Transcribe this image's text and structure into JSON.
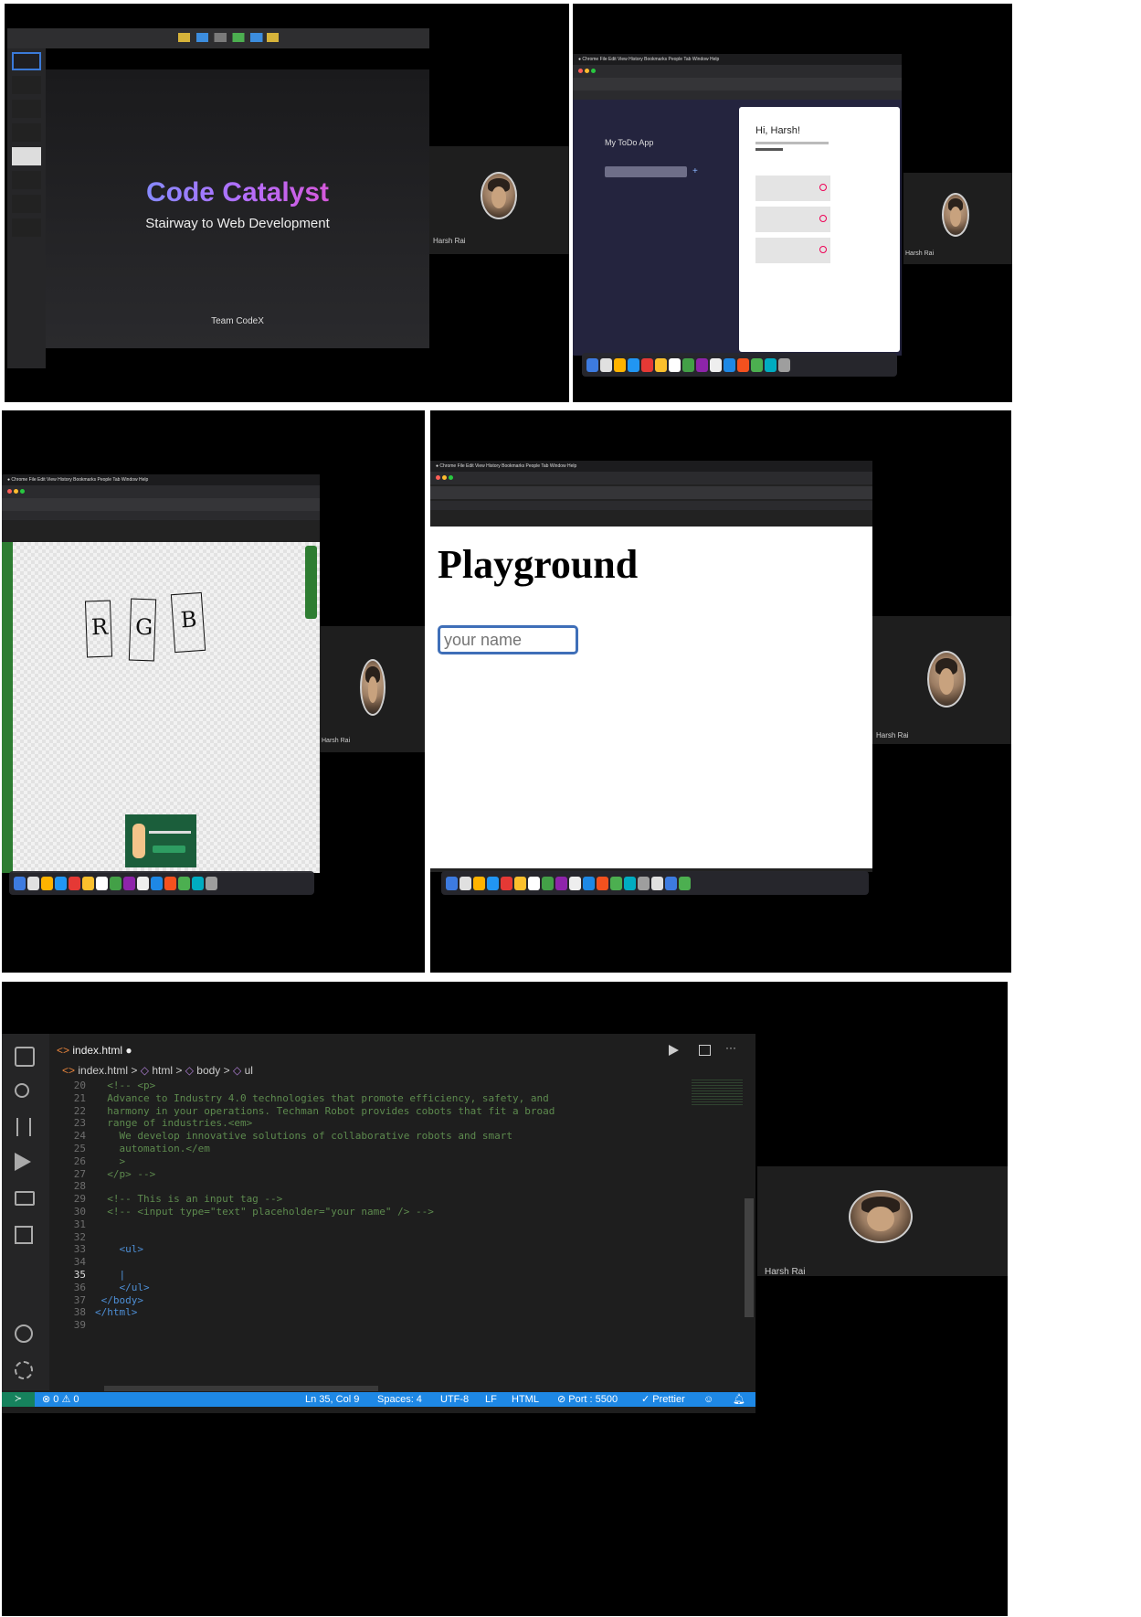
{
  "participant_name": "Harsh Rai",
  "slide": {
    "title": "Code Catalyst",
    "subtitle": "Stairway to Web Development",
    "footer": "Team CodeX"
  },
  "todo": {
    "app_title": "My ToDo App",
    "greeting": "Hi, Harsh!"
  },
  "whiteboard": {
    "letters": [
      "R",
      "G",
      "B"
    ]
  },
  "playground": {
    "heading": "Playground",
    "input_placeholder": "your name"
  },
  "editor": {
    "tab_label": "index.html",
    "breadcrumb": [
      "index.html",
      "html",
      "body",
      "ul"
    ],
    "lines": [
      {
        "n": "20",
        "text": "  <!-- <p>",
        "cls": "cm"
      },
      {
        "n": "21",
        "text": "  Advance to Industry 4.0 technologies that promote efficiency, safety, and",
        "cls": "cm"
      },
      {
        "n": "22",
        "text": "  harmony in your operations. Techman Robot provides cobots that fit a broad",
        "cls": "cm"
      },
      {
        "n": "23",
        "text": "  range of industries.<em>",
        "cls": "cm"
      },
      {
        "n": "24",
        "text": "    We develop innovative solutions of collaborative robots and smart",
        "cls": "cm"
      },
      {
        "n": "25",
        "text": "    automation.</em",
        "cls": "cm"
      },
      {
        "n": "26",
        "text": "    >",
        "cls": "cm"
      },
      {
        "n": "27",
        "text": "  </p> -->",
        "cls": "cm"
      },
      {
        "n": "28",
        "text": "",
        "cls": "cm"
      },
      {
        "n": "29",
        "text": "  <!-- This is an input tag -->",
        "cls": "cm"
      },
      {
        "n": "30",
        "text": "  <!-- <input type=\"text\" placeholder=\"your name\" /> -->",
        "cls": "cm"
      },
      {
        "n": "31",
        "text": "",
        "cls": "cm"
      },
      {
        "n": "32",
        "text": "",
        "cls": "cm"
      },
      {
        "n": "33",
        "text": "    <ul>",
        "cls": "tg"
      },
      {
        "n": "34",
        "text": "",
        "cls": "tg"
      },
      {
        "n": "35",
        "text": "    |",
        "cls": "tg"
      },
      {
        "n": "36",
        "text": "    </ul>",
        "cls": "tg"
      },
      {
        "n": "37",
        "text": " </body>",
        "cls": "tg"
      },
      {
        "n": "38",
        "text": "</html>",
        "cls": "tg"
      },
      {
        "n": "39",
        "text": "",
        "cls": "tg"
      }
    ],
    "status": {
      "problems": "⊗ 0 ⚠ 0",
      "cursor": "Ln 35, Col 9",
      "spaces": "Spaces: 4",
      "encoding": "UTF-8",
      "eol": "LF",
      "language": "HTML",
      "port": "⊘ Port : 5500",
      "prettier": "✓ Prettier"
    }
  },
  "colors": {
    "vscode_status": "#1e88e5",
    "slide_gradient_start": "#5aa7ff",
    "slide_gradient_end": "#ff3fb3",
    "todo_bg": "#24243e"
  }
}
